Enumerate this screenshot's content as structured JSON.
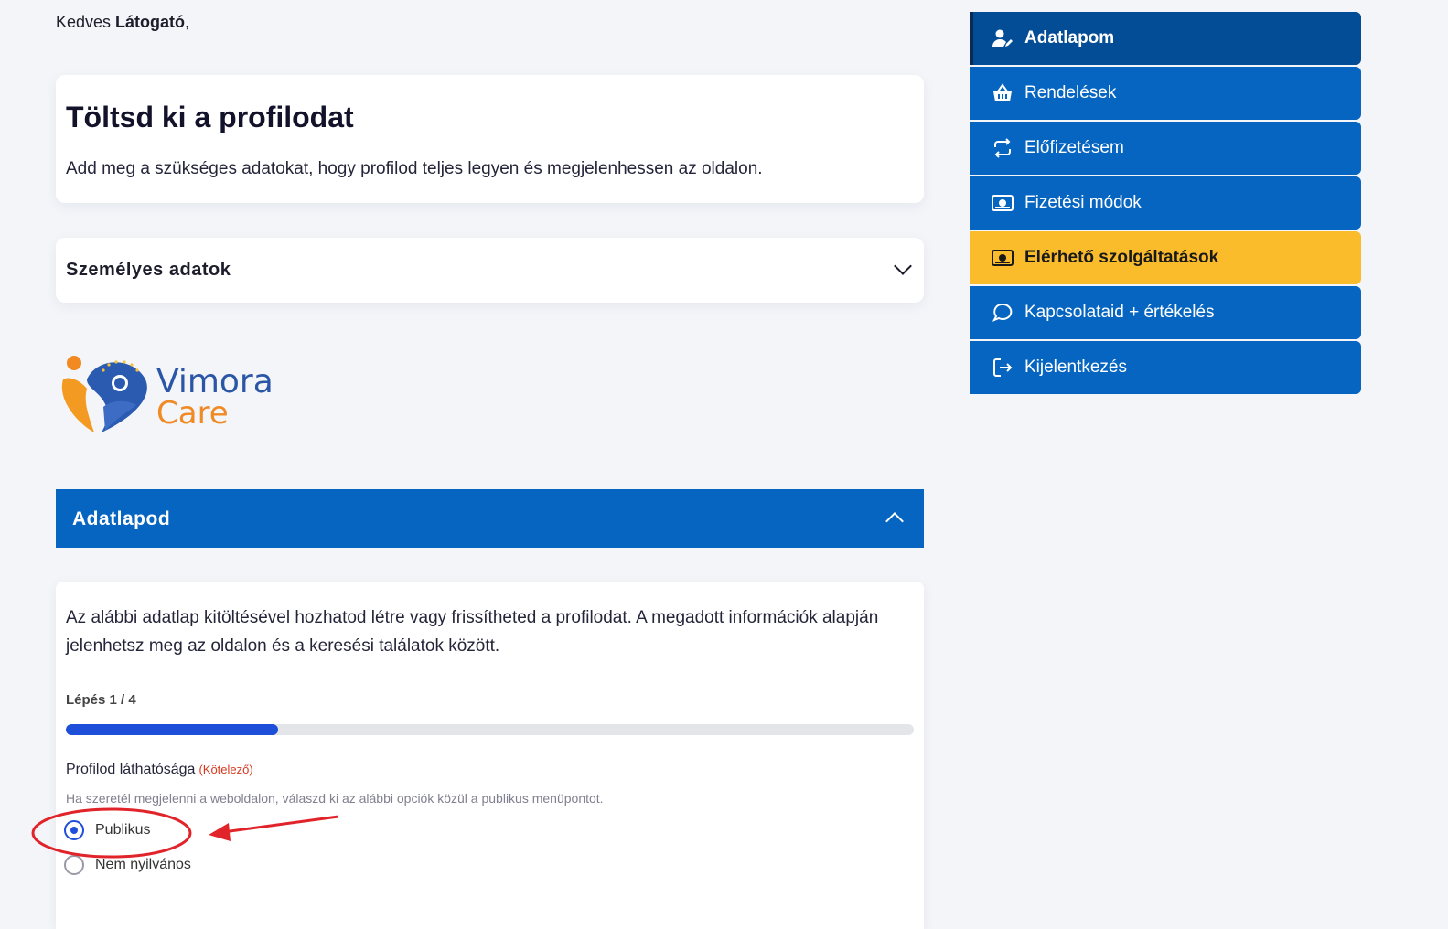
{
  "greeting": {
    "prefix": "Kedves ",
    "name": "Látogató",
    "suffix": ","
  },
  "intro": {
    "title": "Töltsd ki a profilodat",
    "text": "Add meg a szükséges adatokat, hogy profilod teljes legyen és megjelenhessen az oldalon."
  },
  "personal": {
    "title": "Személyes adatok"
  },
  "logo": {
    "line1": "Vimora",
    "line2": "Care"
  },
  "accordion": {
    "title": "Adatlapod"
  },
  "form": {
    "description": "Az alábbi adatlap kitöltésével hozhatod létre vagy frissítheted a profilodat. A megadott információk alapján jelenhetsz meg az oldalon és a keresési találatok között.",
    "step": "Lépés 1 / 4",
    "progress_fraction": 0.25,
    "visibility_label": "Profilod láthatósága",
    "required": "(Kötelező)",
    "help": "Ha szeretél megjelenni a weboldalon, válaszd ki az alábbi opciók közül a publikus menüpontot.",
    "options": [
      {
        "label": "Publikus",
        "checked": true
      },
      {
        "label": "Nem nyilvános",
        "checked": false
      }
    ]
  },
  "sidebar": {
    "items": [
      {
        "label": "Adatlapom",
        "icon": "user-edit-icon"
      },
      {
        "label": "Rendelések",
        "icon": "basket-icon"
      },
      {
        "label": "Előfizetésem",
        "icon": "repeat-icon"
      },
      {
        "label": "Fizetési módok",
        "icon": "money-icon"
      },
      {
        "label": "Elérhető szolgáltatások",
        "icon": "money-icon"
      },
      {
        "label": "Kapcsolataid + értékelés",
        "icon": "chat-icon"
      },
      {
        "label": "Kijelentkezés",
        "icon": "logout-icon"
      }
    ]
  },
  "colors": {
    "primary": "#0565c0",
    "active": "#034d96",
    "highlight": "#fbbc2b",
    "progress": "#1d4fd8",
    "annotation": "#e0242a"
  }
}
